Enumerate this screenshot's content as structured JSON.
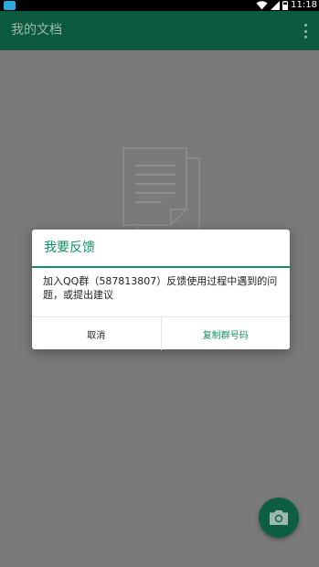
{
  "status_bar": {
    "time": "11:18",
    "icons": [
      "app-notification-icon",
      "wifi-icon",
      "signal-icon",
      "battery-icon"
    ]
  },
  "app_bar": {
    "title": "我的文档",
    "menu_icon": "overflow-menu-icon",
    "background_color": "#0b5a3f"
  },
  "empty_state": {
    "icon": "document-icon"
  },
  "fab": {
    "icon": "camera-icon",
    "color": "#0d5e42"
  },
  "dialog": {
    "title": "我要反馈",
    "message": "加入QQ群（587813807）反馈使用过程中遇到的问题，或提出建议",
    "cancel_label": "取消",
    "confirm_label": "复制群号码",
    "accent_color": "#168e63"
  }
}
